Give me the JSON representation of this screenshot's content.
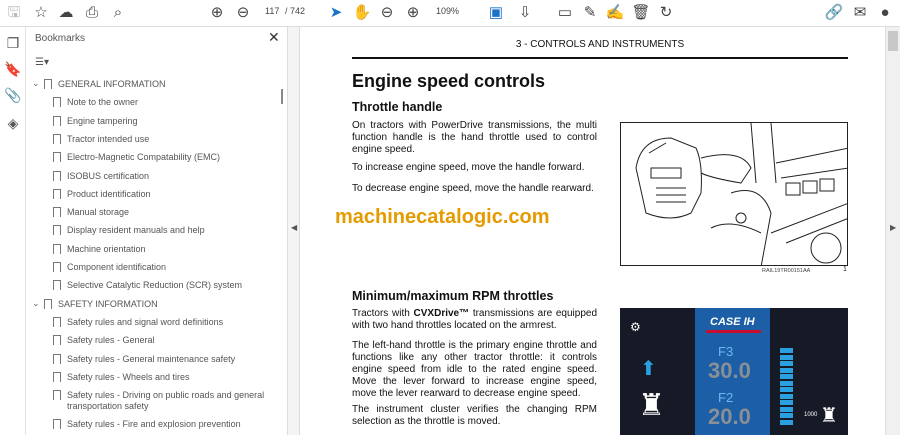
{
  "toolbar": {
    "page_current": "117",
    "page_total": "/ 742",
    "zoom": "109%",
    "icons": [
      "save-icon",
      "star-icon",
      "upload-icon",
      "print-icon",
      "search-icon",
      "page-up-icon",
      "page-down-icon",
      "select-cursor-icon",
      "hand-icon",
      "zoom-out-icon",
      "zoom-in-icon",
      "fit-page-icon",
      "scroll-mode-icon",
      "comment-icon",
      "pen-icon",
      "sign-icon",
      "delete-icon",
      "rotate-icon",
      "share-link-icon",
      "mail-icon",
      "account-icon"
    ]
  },
  "panel": {
    "title": "Bookmarks",
    "close": "✕",
    "options": "☰▾",
    "sections": [
      {
        "label": "GENERAL INFORMATION",
        "items": [
          "Note to the owner",
          "Engine tampering",
          "Tractor intended use",
          "Electro-Magnetic Compatability (EMC)",
          "ISOBUS certification",
          "Product identification",
          "Manual storage",
          "Display resident manuals and help",
          "Machine orientation",
          "Component identification",
          "Selective Catalytic Reduction (SCR) system"
        ]
      },
      {
        "label": "SAFETY INFORMATION",
        "items": [
          "Safety rules and signal word definitions",
          "Safety rules - General",
          "Safety rules - General maintenance safety",
          "Safety rules - Wheels and tires",
          "Safety rules - Driving on public roads and general transportation safety",
          "Safety rules - Fire and explosion prevention"
        ]
      }
    ]
  },
  "doc": {
    "header": "3 - CONTROLS AND INSTRUMENTS",
    "title": "Engine speed controls",
    "s1": {
      "heading": "Throttle handle",
      "p1": "On tractors with PowerDrive transmissions, the multi function handle is the hand throttle used to control engine speed.",
      "p2": "To increase engine speed, move the handle forward.",
      "p3": "To decrease engine speed, move the handle rearward."
    },
    "watermark": "machinecatalogic.com",
    "fig1": {
      "caption": "RAIL19TR00151AA",
      "number": "1"
    },
    "s2": {
      "heading": "Minimum/maximum RPM throttles",
      "p1_pre": "Tractors with ",
      "p1_bold": "CVXDrive™",
      "p1_post": " transmissions are equipped with two hand throttles located on the armrest.",
      "p2": "The left-hand throttle is the primary engine throttle and functions like any other tractor throttle: it controls engine speed from idle to the rated engine speed. Move the lever forward to increase engine speed, move the lever rearward to decrease engine speed.",
      "p3": "The instrument cluster verifies the changing RPM selection as the throttle is moved."
    },
    "fig2": {
      "brand": "CASE IH",
      "gear1": "F3",
      "speed1": "30.0",
      "gear2": "F2",
      "speed2": "20.0",
      "pto": "1000"
    }
  }
}
